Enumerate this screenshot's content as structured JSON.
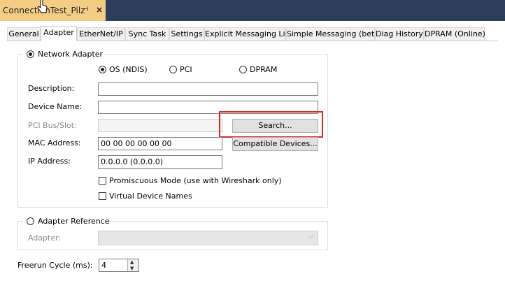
{
  "document_tab": {
    "title": "ConnectionTest_Pilz",
    "pin_glyph": "⊣",
    "close_glyph": "×"
  },
  "tabs": [
    {
      "label": "General",
      "active": false
    },
    {
      "label": "Adapter",
      "active": true
    },
    {
      "label": "EtherNet/IP",
      "active": false
    },
    {
      "label": "Sync Task",
      "active": false
    },
    {
      "label": "Settings",
      "active": false
    },
    {
      "label": "Explicit Messaging List",
      "active": false
    },
    {
      "label": "Simple Messaging (beta)",
      "active": false
    },
    {
      "label": "Diag History",
      "active": false
    },
    {
      "label": "DPRAM (Online)",
      "active": false
    }
  ],
  "network_adapter": {
    "label": "Network Adapter",
    "selected": true,
    "mode_options": [
      {
        "label": "OS (NDIS)",
        "selected": true
      },
      {
        "label": "PCI",
        "selected": false
      },
      {
        "label": "DPRAM",
        "selected": false
      }
    ],
    "description_label": "Description:",
    "description_value": "",
    "device_name_label": "Device Name:",
    "device_name_value": "",
    "pci_label": "PCI Bus/Slot:",
    "pci_value": "",
    "search_button": "Search...",
    "mac_label": "MAC Address:",
    "mac_value": "00 00 00 00 00 00",
    "compatible_button": "Compatible Devices...",
    "ip_label": "IP Address:",
    "ip_value": "0.0.0.0 (0.0.0.0)",
    "promiscuous_label": "Promiscuous Mode (use with Wireshark only)",
    "promiscuous_checked": false,
    "virtual_names_label": "Virtual Device Names",
    "virtual_names_checked": false
  },
  "adapter_reference": {
    "label": "Adapter Reference",
    "selected": false,
    "adapter_label": "Adapter:",
    "adapter_value": ""
  },
  "freerun": {
    "label": "Freerun Cycle (ms):",
    "value": "4"
  },
  "colors": {
    "doc_strip": "#2b3e5c",
    "doc_tab": "#f5cc84",
    "highlight": "#e02525"
  },
  "icons": [
    "pin-icon",
    "close-icon",
    "mouse-cursor-icon",
    "chevron-down-icon",
    "spin-up-icon",
    "spin-down-icon"
  ]
}
